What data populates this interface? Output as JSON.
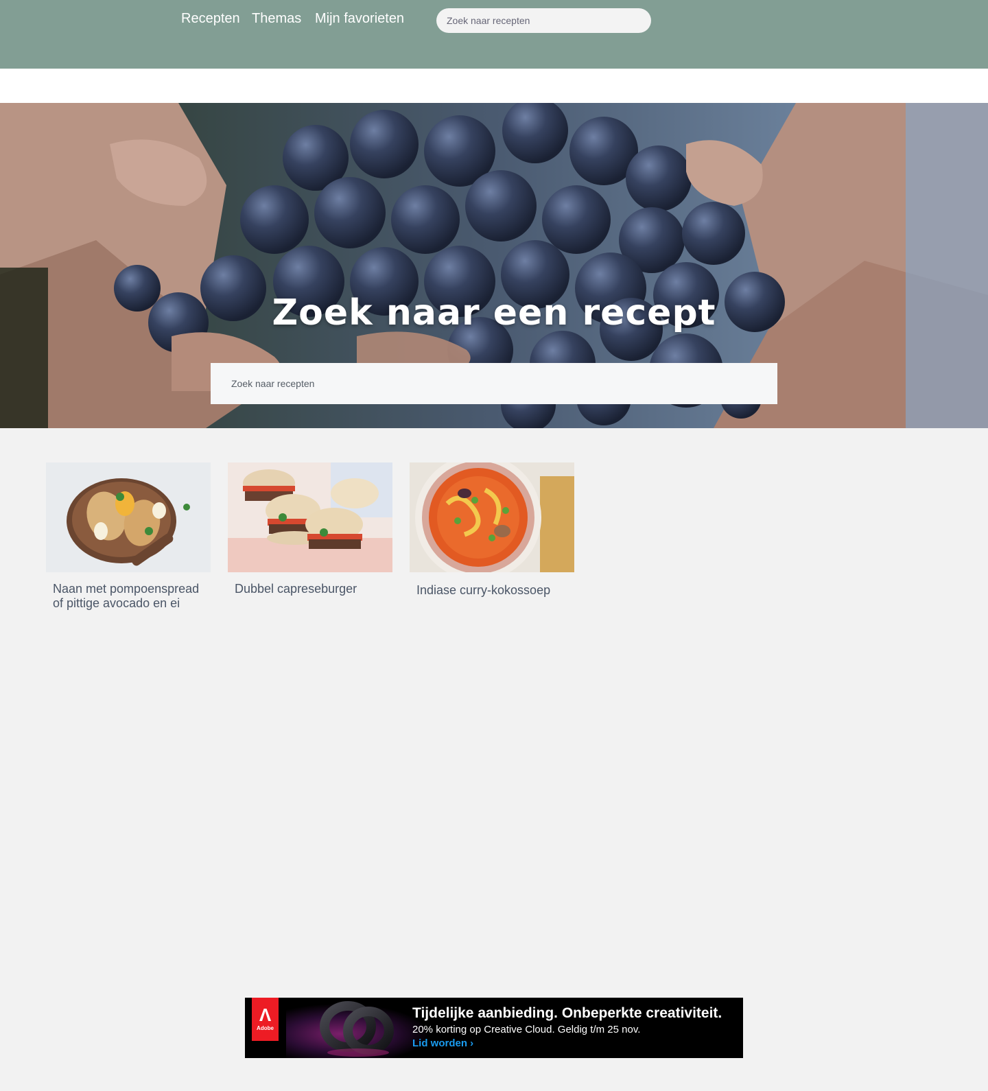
{
  "nav": {
    "items": [
      {
        "label": "Recepten"
      },
      {
        "label": "Themas"
      },
      {
        "label": "Mijn favorieten"
      }
    ],
    "search_placeholder": "Zoek naar recepten"
  },
  "hero": {
    "title": "Zoek naar een recept",
    "search_placeholder": "Zoek naar recepten"
  },
  "recipes": [
    {
      "title": "Naan met pompoenspread of pittige avocado en ei"
    },
    {
      "title": "Dubbel capreseburger"
    },
    {
      "title": "Indiase curry-kokossoep"
    }
  ],
  "ad": {
    "brand": "Adobe",
    "headline": "Tijdelijke aanbieding. Onbeperkte creativiteit.",
    "subtext": "20% korting op Creative Cloud. Geldig t/m 25 nov.",
    "cta": "Lid worden ›"
  },
  "colors": {
    "topbar": "#829e94",
    "page_bg": "#f2f2f2",
    "card_title": "#4a5566",
    "ad_cta": "#1a9cf0",
    "adobe_red": "#ed1c24"
  }
}
